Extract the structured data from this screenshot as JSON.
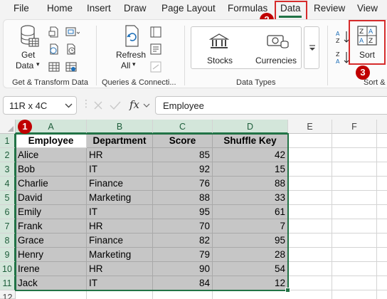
{
  "tabs": [
    "File",
    "Home",
    "Insert",
    "Draw",
    "Page Layout",
    "Formulas",
    "Data",
    "Review",
    "View"
  ],
  "active_tab": "Data",
  "ribbon": {
    "get_data": {
      "line1": "Get",
      "line2": "Data"
    },
    "refresh": {
      "line1": "Refresh",
      "line2": "All"
    },
    "stocks": "Stocks",
    "currencies": "Currencies",
    "sort": "Sort",
    "groups": {
      "get_transform": "Get & Transform Data",
      "queries": "Queries & Connecti...",
      "data_types": "Data Types",
      "sort_filter": "Sort &"
    }
  },
  "badges": [
    "1",
    "2",
    "3"
  ],
  "formula_bar": {
    "name_box": "11R x 4C",
    "fx": "fx",
    "value": "Employee"
  },
  "columns": [
    "A",
    "B",
    "C",
    "D",
    "E",
    "F"
  ],
  "rows": [
    "1",
    "2",
    "3",
    "4",
    "5",
    "6",
    "7",
    "8",
    "9",
    "10",
    "11",
    "12"
  ],
  "table": {
    "headers": [
      "Employee",
      "Department",
      "Score",
      "Shuffle Key"
    ],
    "records": [
      [
        "Alice",
        "HR",
        "85",
        "42"
      ],
      [
        "Bob",
        "IT",
        "92",
        "15"
      ],
      [
        "Charlie",
        "Finance",
        "76",
        "88"
      ],
      [
        "David",
        "Marketing",
        "88",
        "33"
      ],
      [
        "Emily",
        "IT",
        "95",
        "61"
      ],
      [
        "Frank",
        "HR",
        "70",
        "7"
      ],
      [
        "Grace",
        "Finance",
        "82",
        "95"
      ],
      [
        "Henry",
        "Marketing",
        "79",
        "28"
      ],
      [
        "Irene",
        "HR",
        "90",
        "54"
      ],
      [
        "Jack",
        "IT",
        "84",
        "12"
      ]
    ]
  },
  "colors": {
    "accent": "#217346",
    "annotation": "#d62b2b",
    "selection_fill": "#c6c6c6"
  }
}
